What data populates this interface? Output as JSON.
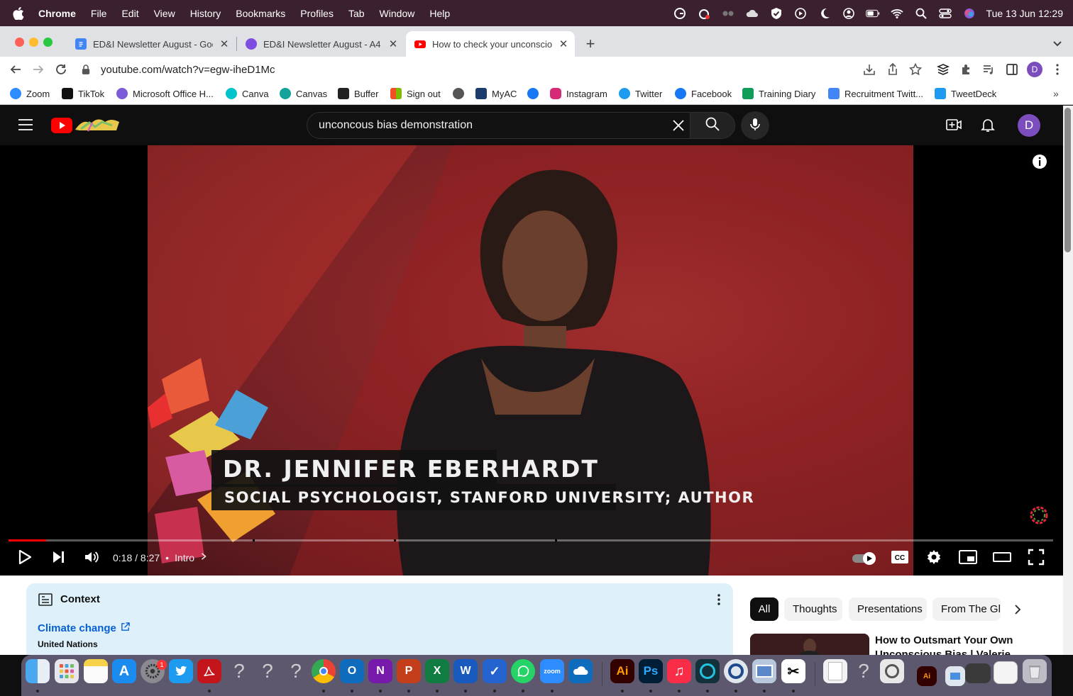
{
  "menubar": {
    "app": "Chrome",
    "items": [
      "File",
      "Edit",
      "View",
      "History",
      "Bookmarks",
      "Profiles",
      "Tab",
      "Window",
      "Help"
    ],
    "clock": "Tue 13 Jun  12:29"
  },
  "tabs": [
    {
      "title": "ED&I Newsletter August - Goog",
      "icon": "google-docs-icon"
    },
    {
      "title": "ED&I Newsletter August - A4",
      "icon": "canva-icon"
    },
    {
      "title": "How to check your unconsciou",
      "icon": "youtube-icon",
      "active": true
    }
  ],
  "toolbar": {
    "url": "youtube.com/watch?v=egw-iheD1Mc",
    "profile_initial": "D"
  },
  "bookmarks": [
    {
      "label": "Zoom",
      "color": "#2d8cff"
    },
    {
      "label": "TikTok",
      "color": "#111111"
    },
    {
      "label": "Microsoft Office H...",
      "color": "#7b5cd6"
    },
    {
      "label": "Canva",
      "color": "#00c4cc"
    },
    {
      "label": "Canvas",
      "color": "#14a39a"
    },
    {
      "label": "Buffer",
      "color": "#222222"
    },
    {
      "label": "Sign out",
      "color": "#f25022"
    },
    {
      "label": "",
      "color": "#555555"
    },
    {
      "label": "MyAC",
      "color": "#1d3c6e"
    },
    {
      "label": "",
      "color": "#1877f2"
    },
    {
      "label": "Instagram",
      "color": "#d62976"
    },
    {
      "label": "Twitter",
      "color": "#1d9bf0"
    },
    {
      "label": "Facebook",
      "color": "#1877f2"
    },
    {
      "label": "Training Diary",
      "color": "#0f9d58"
    },
    {
      "label": "Recruitment Twitt...",
      "color": "#4285f4"
    },
    {
      "label": "TweetDeck",
      "color": "#1d9bf0"
    }
  ],
  "youtube": {
    "search_query": "unconcous bias demonstration",
    "avatar_initial": "D"
  },
  "video": {
    "name_caption": "DR. JENNIFER EBERHARDT",
    "role_caption": "SOCIAL PSYCHOLOGIST, STANFORD UNIVERSITY; AUTHOR",
    "time": "0:18 / 8:27",
    "chapter": "Intro",
    "progress_fraction": 0.036,
    "chapter_marks": [
      0.234,
      0.369,
      0.523
    ]
  },
  "context": {
    "title": "Context",
    "link": "Climate change",
    "source": "United Nations"
  },
  "chips": [
    "All",
    "Thoughts",
    "Presentations",
    "From The Gl"
  ],
  "recommendation": {
    "title": "How to Outsmart Your Own Unconscious Bias | Valerie"
  },
  "dock": {
    "settings_badge": "1"
  }
}
